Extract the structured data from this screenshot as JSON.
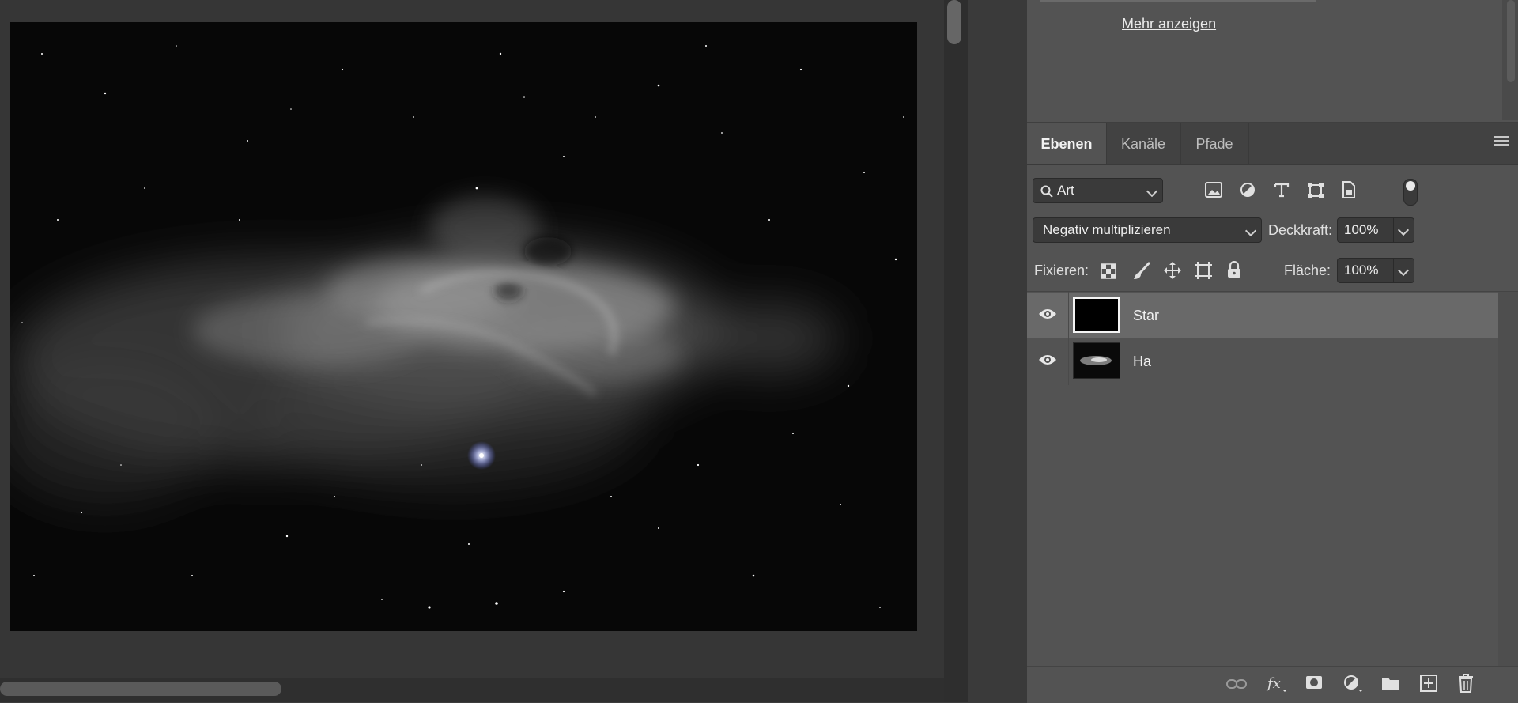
{
  "upper_panel": {
    "more_link": "Mehr anzeigen"
  },
  "tabs": [
    {
      "label": "Ebenen",
      "active": true
    },
    {
      "label": "Kanäle",
      "active": false
    },
    {
      "label": "Pfade",
      "active": false
    }
  ],
  "filter": {
    "kind_value": "Art",
    "icons": [
      "image-filter-icon",
      "adjustment-filter-icon",
      "type-filter-icon",
      "shape-filter-icon",
      "smart-object-filter-icon",
      "filter-toggle-switch"
    ]
  },
  "blend": {
    "mode_value": "Negativ multiplizieren",
    "opacity_label": "Deckkraft:",
    "opacity_value": "100%"
  },
  "lock": {
    "label": "Fixieren:",
    "icons": [
      "lock-transparent-pixels-icon",
      "lock-image-pixels-icon",
      "lock-position-icon",
      "lock-artboard-icon",
      "lock-all-icon"
    ],
    "fill_label": "Fläche:",
    "fill_value": "100%"
  },
  "layers": [
    {
      "name": "Star",
      "selected": true,
      "visible": true
    },
    {
      "name": "Ha",
      "selected": false,
      "visible": true
    }
  ],
  "bottom_icons": [
    "link-layers-icon",
    "fx-icon",
    "add-mask-icon",
    "adjustment-layer-icon",
    "new-group-icon",
    "new-layer-icon",
    "delete-layer-icon"
  ],
  "colors": {
    "panel_bg": "#535353",
    "selected_row": "#696969",
    "canvas_bg": "#363636"
  }
}
